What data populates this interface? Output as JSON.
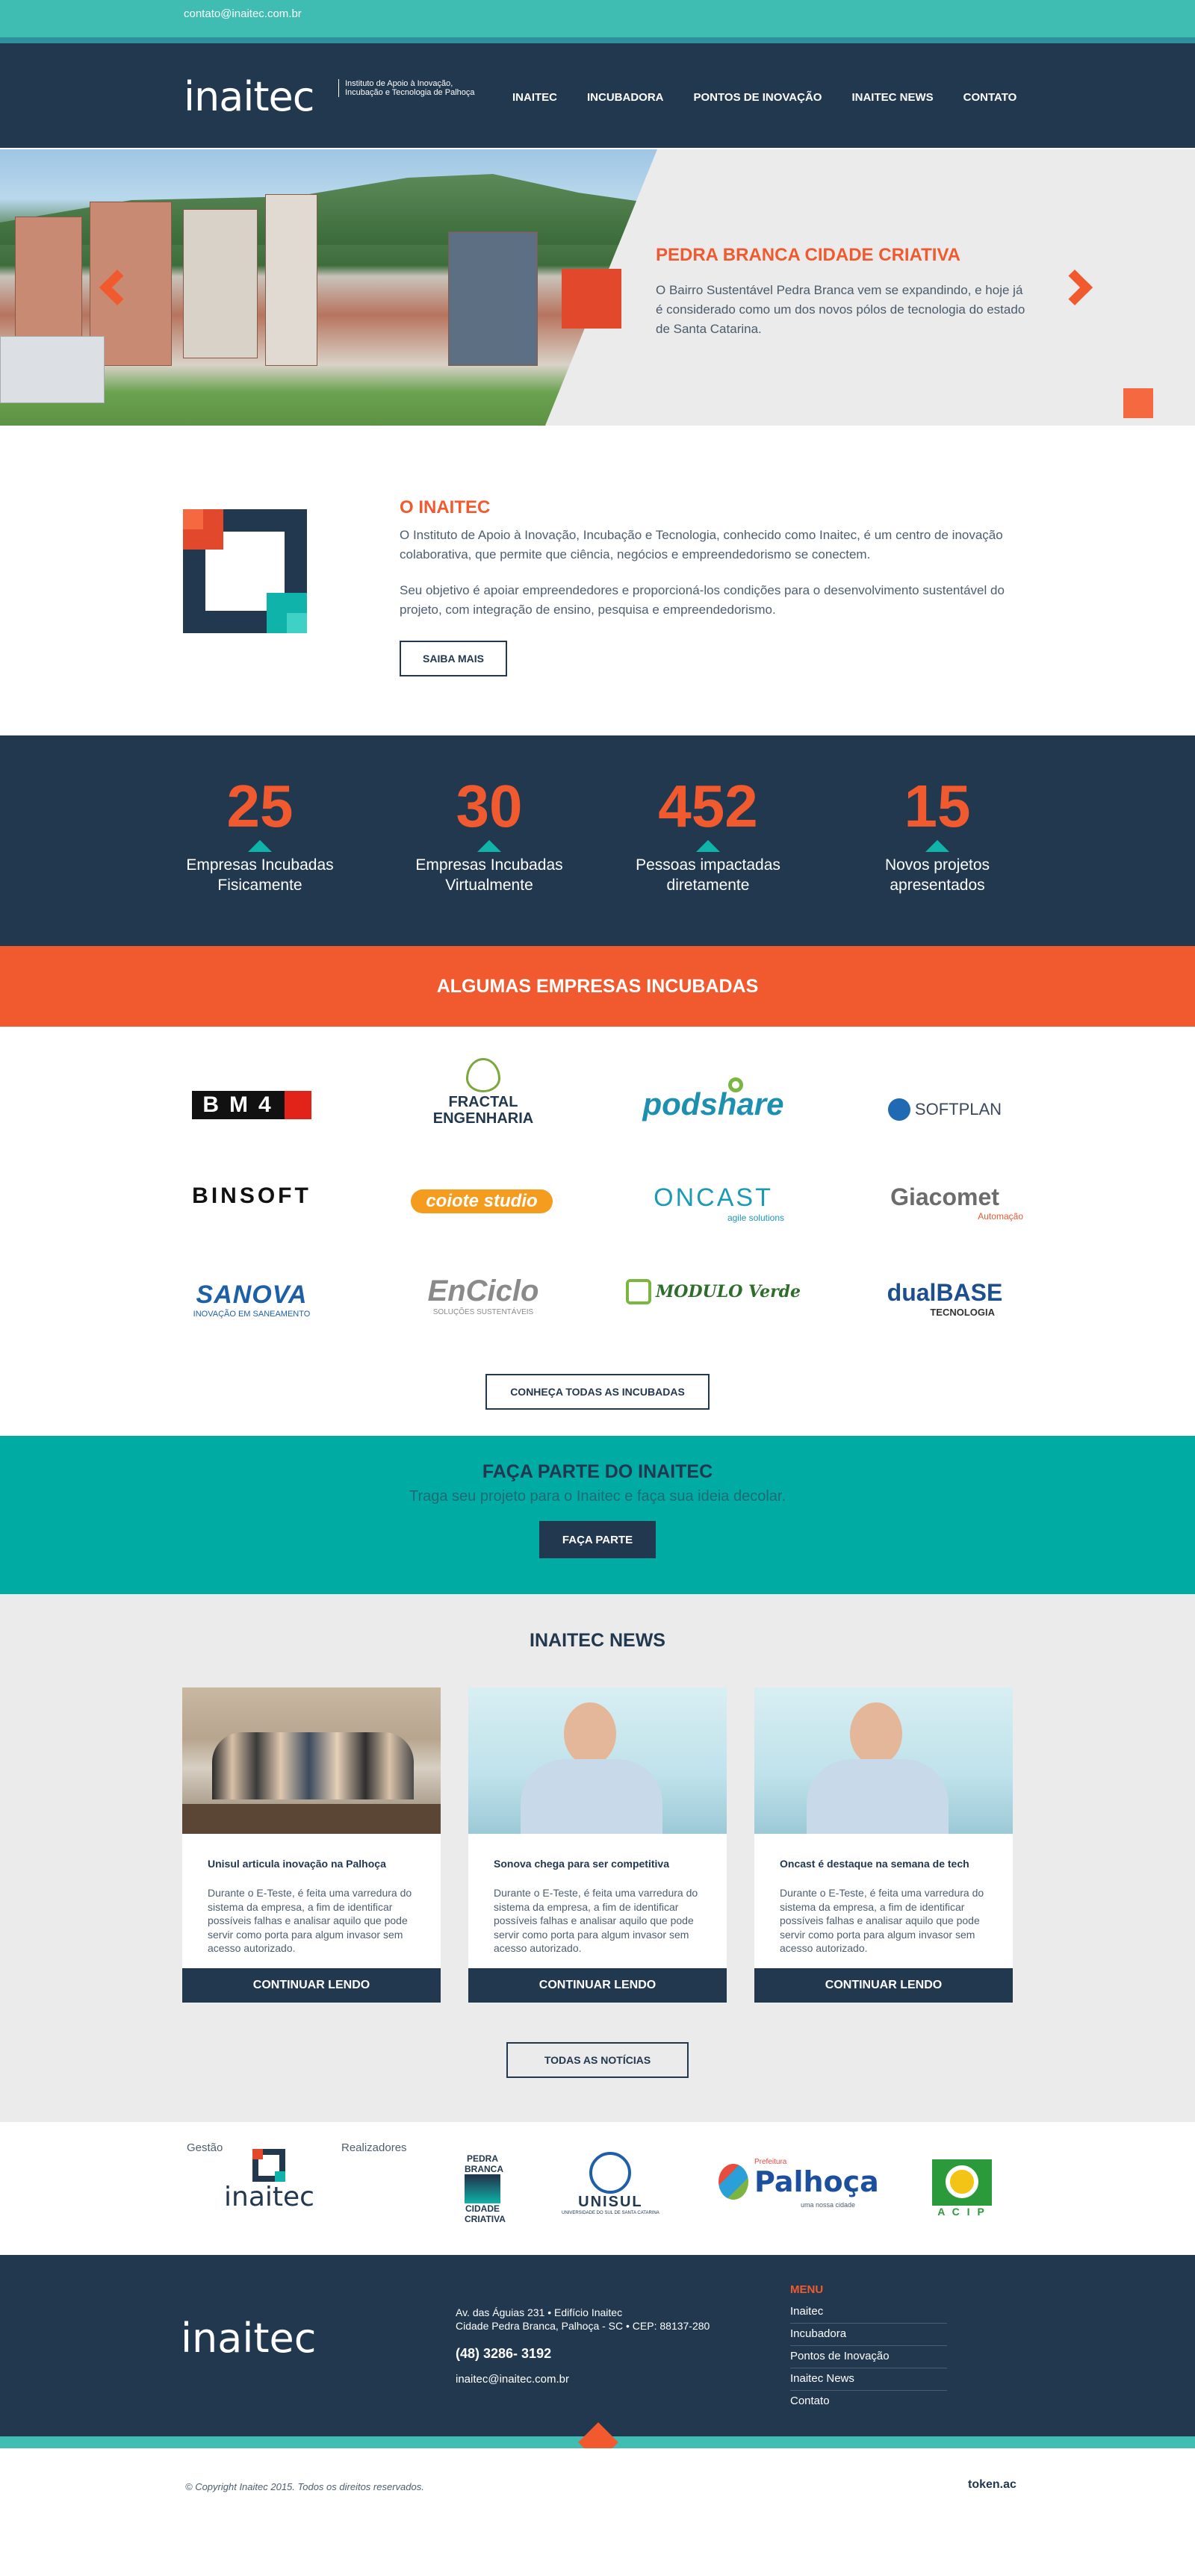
{
  "topbar": {
    "email": "contato@inaitec.com.br"
  },
  "header": {
    "logo": "inaitec",
    "logo_sub": "Instituto de Apoio à Inovação, Incubação e Tecnologia de Palhoça",
    "menu": [
      "INAITEC",
      "INCUBADORA",
      "PONTOS DE INOVAÇÃO",
      "INAITEC NEWS",
      "CONTATO"
    ]
  },
  "hero": {
    "title": "PEDRA BRANCA CIDADE CRIATIVA",
    "text": "O Bairro Sustentável Pedra Branca vem se expandindo, e hoje já é considerado como um dos novos pólos de tecnologia do estado de Santa Catarina."
  },
  "about": {
    "title": "O INAITEC",
    "p1": "O Instituto de Apoio à Inovação, Incubação e Tecnologia, conhecido como Inaitec, é um centro de inovação colaborativa, que permite que ciência, negócios e empreendedorismo se conectem.",
    "p2": "Seu objetivo é apoiar empreendedores e proporcioná-los condições para o desenvolvimento sustentável do projeto, com integração de ensino, pesquisa e empreendedorismo.",
    "button": "SAIBA MAIS"
  },
  "stats": [
    {
      "num": "25",
      "label1": "Empresas Incubadas",
      "label2": "Fisicamente"
    },
    {
      "num": "30",
      "label1": "Empresas Incubadas",
      "label2": "Virtualmente"
    },
    {
      "num": "452",
      "label1": "Pessoas impactadas",
      "label2": "diretamente"
    },
    {
      "num": "15",
      "label1": "Novos projetos",
      "label2": "apresentados"
    }
  ],
  "incubadas": {
    "title": "ALGUMAS EMPRESAS INCUBADAS",
    "logos": [
      "BM4",
      "FRACTAL",
      "ENGENHARIA",
      "podshare",
      "SOFTPLAN",
      "BINSOFT",
      "coiote studio",
      "ONCAST",
      "agile solutions",
      "Giacomet",
      "Automação",
      "SANOVA",
      "INOVAÇÃO EM SANEAMENTO",
      "EnCiclo",
      "SOLUÇÕES SUSTENTÁVEIS",
      "MODULO Verde",
      "dualBASE",
      "TECNOLOGIA"
    ],
    "button": "CONHEÇA TODAS AS INCUBADAS"
  },
  "cta": {
    "title": "FAÇA PARTE DO INAITEC",
    "text": "Traga seu projeto para o Inaitec e faça sua ideia decolar.",
    "button": "FAÇA PARTE"
  },
  "news": {
    "title": "INAITEC NEWS",
    "cards": [
      {
        "title": "Unisul articula inovação na Palhoça",
        "text": "Durante o E-Teste, é feita uma varredura do sistema da empresa, a fim de identificar possíveis falhas e analisar aquilo que pode servir como porta para algum invasor sem acesso autorizado.",
        "more": "CONTINUAR LENDO"
      },
      {
        "title": "Sonova chega para ser competitiva",
        "text": "Durante o E-Teste, é feita uma varredura do sistema da empresa, a fim de identificar possíveis falhas e analisar aquilo que pode servir como porta para algum invasor sem acesso autorizado.",
        "more": "CONTINUAR LENDO"
      },
      {
        "title": "Oncast é destaque na semana de tech",
        "text": "Durante o E-Teste, é feita uma varredura do sistema da empresa, a fim de identificar possíveis falhas e analisar aquilo que pode servir como porta para algum invasor sem acesso autorizado.",
        "more": "CONTINUAR LENDO"
      }
    ],
    "button": "TODAS AS NOTÍCIAS"
  },
  "partners": {
    "gestao": "Gestão",
    "realizadores": "Realizadores",
    "logos": [
      "inaitec",
      "PEDRA BRANCA",
      "CIDADE CRIATIVA",
      "UNISUL",
      "UNIVERSIDADE DO SUL DE SANTA CATARINA",
      "Prefeitura",
      "Palhoça",
      "uma nossa cidade",
      "A C I P"
    ]
  },
  "footer": {
    "logo": "inaitec",
    "address1": "Av. das Águias 231 • Edifício Inaitec",
    "address2": "Cidade Pedra Branca, Palhoça - SC • CEP: 88137-280",
    "phone": "(48) 3286- 3192",
    "email": "inaitec@inaitec.com.br",
    "menu_title": "MENU",
    "menu": [
      "Inaitec",
      "Incubadora",
      "Pontos de Inovação",
      "Inaitec News",
      "Contato"
    ],
    "copyright": "© Copyright Inaitec 2015. Todos os direitos reservados.",
    "credit": "token.ac"
  },
  "colors": {
    "navy": "#22384f",
    "orange": "#f15a2f",
    "teal": "#00aba4",
    "light_teal": "#3fbdb2"
  }
}
